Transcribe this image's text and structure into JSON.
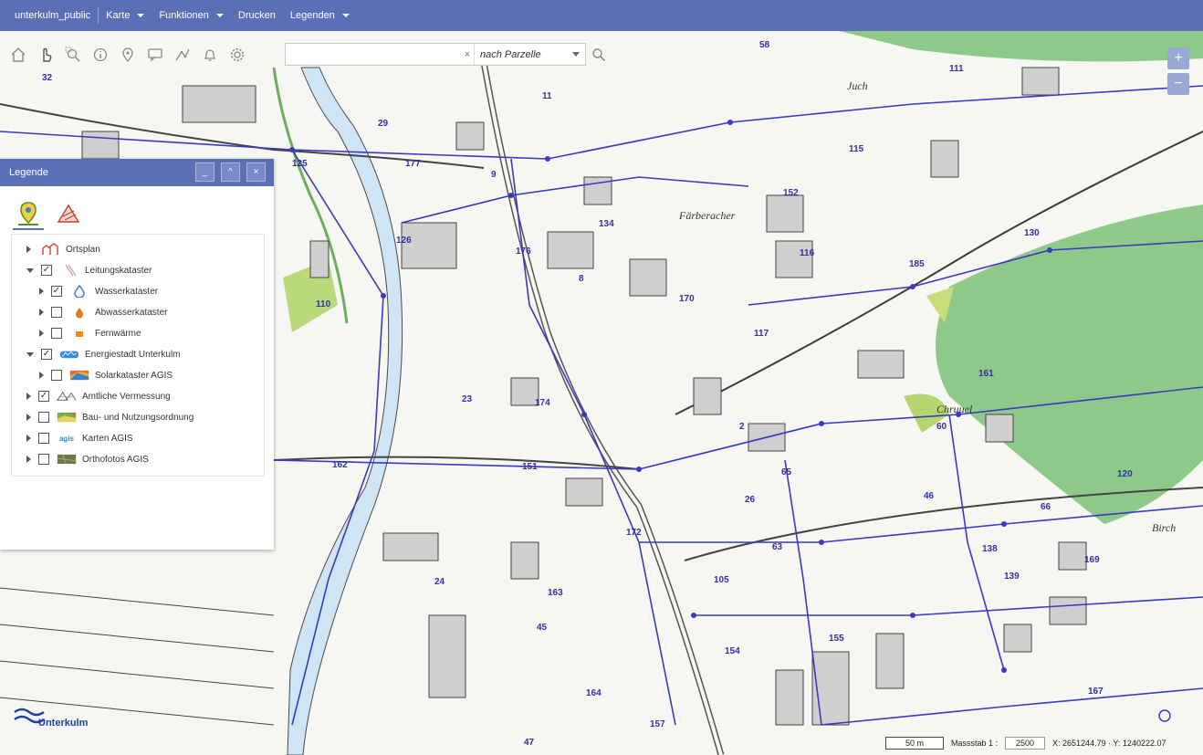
{
  "topbar": {
    "project": "unterkulm_public",
    "menus": [
      {
        "label": "Karte",
        "dropdown": true
      },
      {
        "label": "Funktionen",
        "dropdown": true
      },
      {
        "label": "Drucken",
        "dropdown": false
      },
      {
        "label": "Legenden",
        "dropdown": true
      }
    ]
  },
  "toolbar": {
    "tools": [
      "home-icon",
      "hand-pointer-icon",
      "zoom-box-icon",
      "info-icon",
      "location-pin-icon",
      "comment-icon",
      "measure-icon",
      "bell-icon",
      "gear-icon"
    ]
  },
  "search": {
    "value": "",
    "clear": "×",
    "mode": "nach Parzelle"
  },
  "zoom": {
    "in": "+",
    "out": "−"
  },
  "legend": {
    "title": "Legende",
    "controls": [
      "_",
      "^",
      "×"
    ],
    "layers": [
      {
        "label": "Ortsplan",
        "level": 0,
        "expanded": false,
        "has_checkbox": false,
        "checked": false,
        "icon": "town-icon",
        "color": "#d0433a"
      },
      {
        "label": "Leitungskataster",
        "level": 0,
        "expanded": true,
        "has_checkbox": true,
        "checked": true,
        "icon": "pipe-icon",
        "color": "#c8a0a0"
      },
      {
        "label": "Wasserkataster",
        "level": 1,
        "expanded": false,
        "has_checkbox": true,
        "checked": true,
        "icon": "water-drop-icon",
        "color": "#2c7bd6"
      },
      {
        "label": "Abwasserkataster",
        "level": 1,
        "expanded": false,
        "has_checkbox": true,
        "checked": false,
        "icon": "wastewater-drop-icon",
        "color": "#e07a22"
      },
      {
        "label": "Fernwärme",
        "level": 1,
        "expanded": false,
        "has_checkbox": true,
        "checked": false,
        "icon": "heat-square-icon",
        "color": "#f08a1c"
      },
      {
        "label": "Energiestadt Unterkulm",
        "level": 0,
        "expanded": true,
        "has_checkbox": true,
        "checked": true,
        "icon": "energy-city-icon",
        "color": "#3a8bd9"
      },
      {
        "label": "Solarkataster AGIS",
        "level": 1,
        "expanded": false,
        "has_checkbox": true,
        "checked": false,
        "icon": "solar-map-icon",
        "color": "#e0b030"
      },
      {
        "label": "Amtliche Vermessung",
        "level": 0,
        "expanded": false,
        "has_checkbox": true,
        "checked": true,
        "icon": "survey-icon",
        "color": "#666666"
      },
      {
        "label": "Bau- und Nutzungsordnung",
        "level": 0,
        "expanded": false,
        "has_checkbox": true,
        "checked": false,
        "icon": "zoning-icon",
        "color": "#6fb04a"
      },
      {
        "label": "Karten AGIS",
        "level": 0,
        "expanded": false,
        "has_checkbox": true,
        "checked": false,
        "icon": "agis-icon",
        "color": "#2d8bd0",
        "badge": "agis"
      },
      {
        "label": "Orthofotos AGIS",
        "level": 0,
        "expanded": false,
        "has_checkbox": true,
        "checked": false,
        "icon": "orthophoto-icon",
        "color": "#6a7a4a"
      }
    ]
  },
  "map_labels": {
    "districts": [
      "Juch",
      "Färberacher",
      "Chruuel",
      "Birch"
    ],
    "parcels": [
      "125",
      "177",
      "176",
      "174",
      "151",
      "115",
      "152",
      "116",
      "185",
      "117",
      "161",
      "120",
      "110",
      "126",
      "134",
      "170",
      "130",
      "162",
      "65",
      "26",
      "63",
      "105",
      "60",
      "46",
      "138",
      "169",
      "139",
      "155",
      "154",
      "163",
      "164",
      "167",
      "157",
      "172",
      "24",
      "45",
      "47",
      "111",
      "58",
      "29",
      "32",
      "11",
      "9",
      "8",
      "23",
      "66",
      "2"
    ]
  },
  "status": {
    "scale_bar": "50 m",
    "scale_label": "Massstab 1 :",
    "scale_value": "2500",
    "coords": "X: 2651244.79 · Y: 1240222.07"
  },
  "logo": {
    "name": "Unterkulm"
  }
}
